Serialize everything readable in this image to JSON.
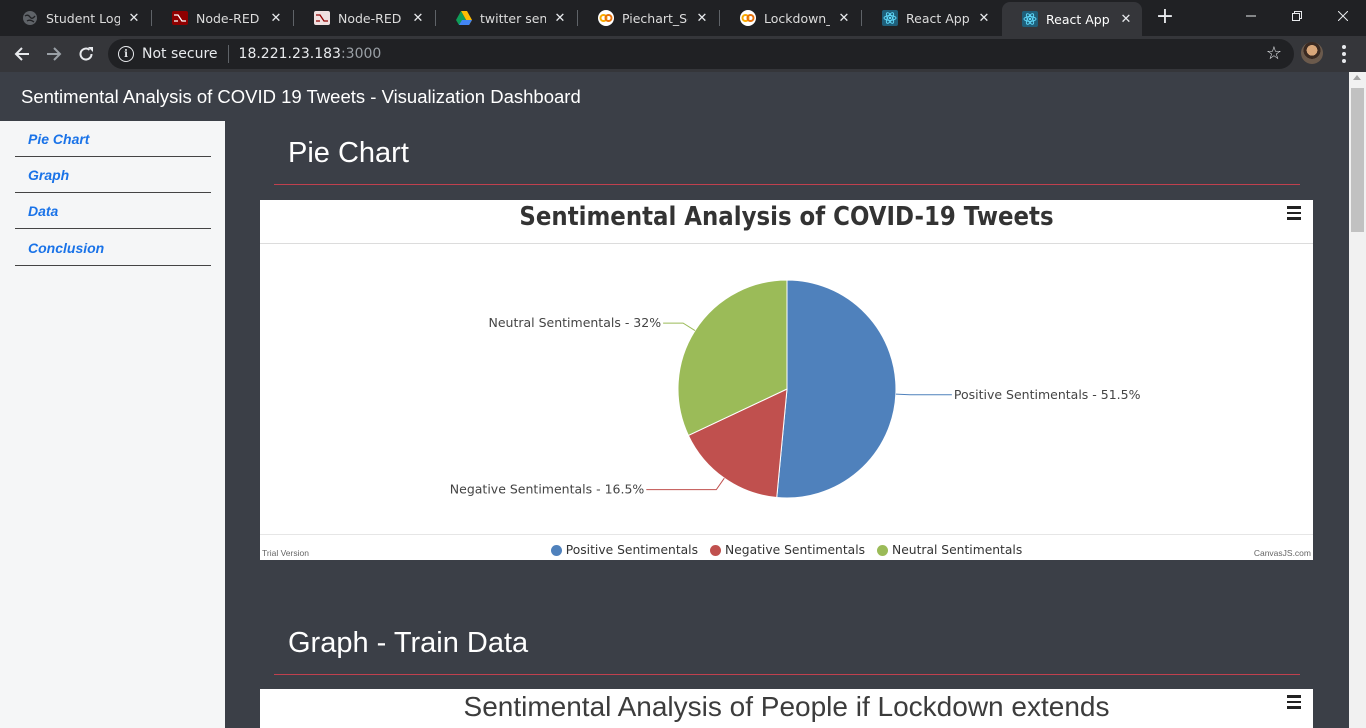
{
  "browser": {
    "tabs": [
      {
        "title": "Student Login",
        "icon": "globe-icon",
        "active": false
      },
      {
        "title": "Node-RED : nc",
        "icon": "node-red-icon",
        "active": false
      },
      {
        "title": "Node-RED Das",
        "icon": "node-red-icon",
        "active": false
      },
      {
        "title": "twitter sentime",
        "icon": "google-drive-icon",
        "active": false
      },
      {
        "title": "Piechart_Sentir",
        "icon": "colab-icon",
        "active": false
      },
      {
        "title": "Lockdown_exte",
        "icon": "colab-icon",
        "active": false
      },
      {
        "title": "React App",
        "icon": "react-icon",
        "active": false
      },
      {
        "title": "React App",
        "icon": "react-icon",
        "active": true
      }
    ],
    "address": {
      "security_label": "Not secure",
      "host": "18.221.23.183",
      "port": ":3000"
    }
  },
  "app": {
    "header_title": "Sentimental Analysis of COVID 19 Tweets - Visualization Dashboard",
    "nav": [
      {
        "label": "Pie Chart"
      },
      {
        "label": "Graph"
      },
      {
        "label": "Data"
      },
      {
        "label": "Conclusion"
      }
    ],
    "sections": [
      {
        "heading": "Pie Chart"
      },
      {
        "heading": "Graph - Train Data"
      }
    ],
    "chart_footer": {
      "trial": "Trial Version",
      "credit": "CanvasJS.com"
    },
    "second_chart_title": "Sentimental Analysis of People if Lockdown extends"
  },
  "chart_data": {
    "type": "pie",
    "title": "Sentimental Analysis of COVID-19 Tweets",
    "legend_placement": "bottom",
    "slices": [
      {
        "name": "Positive Sentimentals",
        "value": 51.5,
        "label": "Positive Sentimentals - 51.5%",
        "color": "#4f81bc"
      },
      {
        "name": "Negative Sentimentals",
        "value": 16.5,
        "label": "Negative Sentimentals - 16.5%",
        "color": "#c0504e"
      },
      {
        "name": "Neutral Sentimentals",
        "value": 32,
        "label": "Neutral Sentimentals - 32%",
        "color": "#9bbb58"
      }
    ]
  },
  "colors": {
    "page_bg": "#3b3f47",
    "accent_rule": "#c0404e",
    "nav_link": "#1a73e8"
  }
}
